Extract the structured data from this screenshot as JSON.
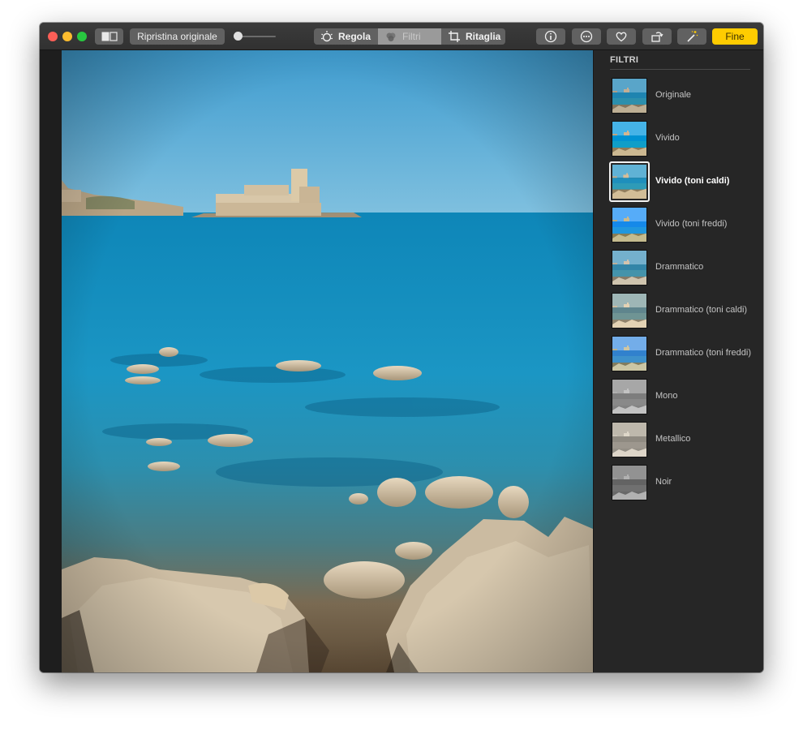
{
  "toolbar": {
    "revert_label": "Ripristina originale",
    "tabs": [
      {
        "label": "Regola",
        "icon": "adjust-dial-icon"
      },
      {
        "label": "Filtri",
        "icon": "filters-circles-icon"
      },
      {
        "label": "Ritaglia",
        "icon": "crop-icon"
      }
    ],
    "active_tab": "Filtri",
    "done_label": "Fine",
    "icons": [
      "info-icon",
      "more-options-icon",
      "heart-icon",
      "rotate-icon",
      "magic-wand-icon"
    ],
    "accent_color": "#ffcc00"
  },
  "sidebar": {
    "title": "FILTRI",
    "selected": "Vivido (toni caldi)",
    "filters": [
      {
        "label": "Originale",
        "tone": "orig"
      },
      {
        "label": "Vivido",
        "tone": "vivid"
      },
      {
        "label": "Vivido (toni caldi)",
        "tone": "warm"
      },
      {
        "label": "Vivido (toni freddi)",
        "tone": "cool"
      },
      {
        "label": "Drammatico",
        "tone": "dram"
      },
      {
        "label": "Drammatico (toni caldi)",
        "tone": "dramwarm"
      },
      {
        "label": "Drammatico (toni freddi)",
        "tone": "dramcool"
      },
      {
        "label": "Mono",
        "tone": "mono"
      },
      {
        "label": "Metallico",
        "tone": "metal"
      },
      {
        "label": "Noir",
        "tone": "noir"
      }
    ]
  }
}
